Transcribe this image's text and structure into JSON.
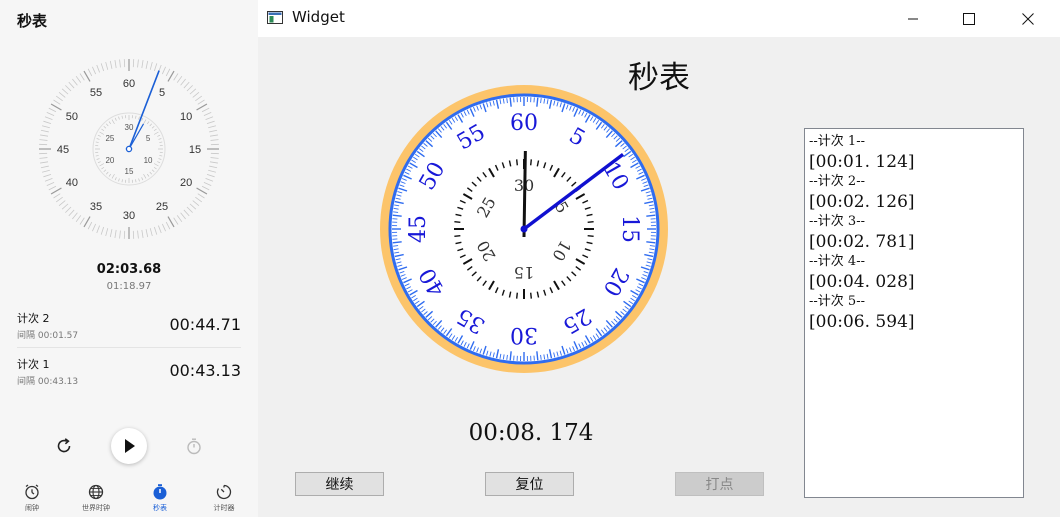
{
  "phone": {
    "title": "秒表",
    "dial": {
      "main_numbers": [
        "60",
        "5",
        "10",
        "15",
        "20",
        "25",
        "30",
        "35",
        "40",
        "45",
        "50",
        "55"
      ],
      "sub_numbers": [
        "30",
        "5",
        "10",
        "15",
        "20",
        "25"
      ]
    },
    "main_time": "02:03.68",
    "sub_time": "01:18.97",
    "laps": [
      {
        "name": "计次 2",
        "interval": "间隔 00:01.57",
        "time": "00:44.71"
      },
      {
        "name": "计次 1",
        "interval": "间隔 00:43.13",
        "time": "00:43.13"
      }
    ],
    "controls": {
      "reset_icon": "reset-icon",
      "play_icon": "play-icon",
      "timer_icon": "stopwatch-icon"
    },
    "nav": [
      {
        "label": "闹钟",
        "icon": "alarm-clock-icon",
        "active": false
      },
      {
        "label": "世界时钟",
        "icon": "globe-icon",
        "active": false
      },
      {
        "label": "秒表",
        "icon": "stopwatch-icon",
        "active": true
      },
      {
        "label": "计时器",
        "icon": "timer-icon",
        "active": false
      }
    ],
    "accent": "#1a5fd6"
  },
  "window": {
    "title": "Widget",
    "controls": {
      "minimize_icon": "minimize-icon",
      "maximize_icon": "maximize-icon",
      "close_icon": "close-icon"
    },
    "heading": "秒表",
    "clock": {
      "outer_numbers": [
        "60",
        "5",
        "10",
        "15",
        "20",
        "25",
        "30",
        "35",
        "40",
        "45",
        "50",
        "55"
      ],
      "inner_numbers": [
        "30",
        "5",
        "10",
        "15",
        "20",
        "25"
      ],
      "ring_color": "#fcc46a",
      "number_color": "#1818d8"
    },
    "elapsed": "00:08. 174",
    "buttons": {
      "continue": "继续",
      "reset": "复位",
      "lap": "打点"
    },
    "laps": [
      {
        "header": "--计次 1--",
        "value": "[00:01. 124]"
      },
      {
        "header": "--计次 2--",
        "value": "[00:02. 126]"
      },
      {
        "header": "--计次 3--",
        "value": "[00:02. 781]"
      },
      {
        "header": "--计次 4--",
        "value": "[00:04. 028]"
      },
      {
        "header": "--计次 5--",
        "value": "[00:06. 594]"
      }
    ]
  }
}
